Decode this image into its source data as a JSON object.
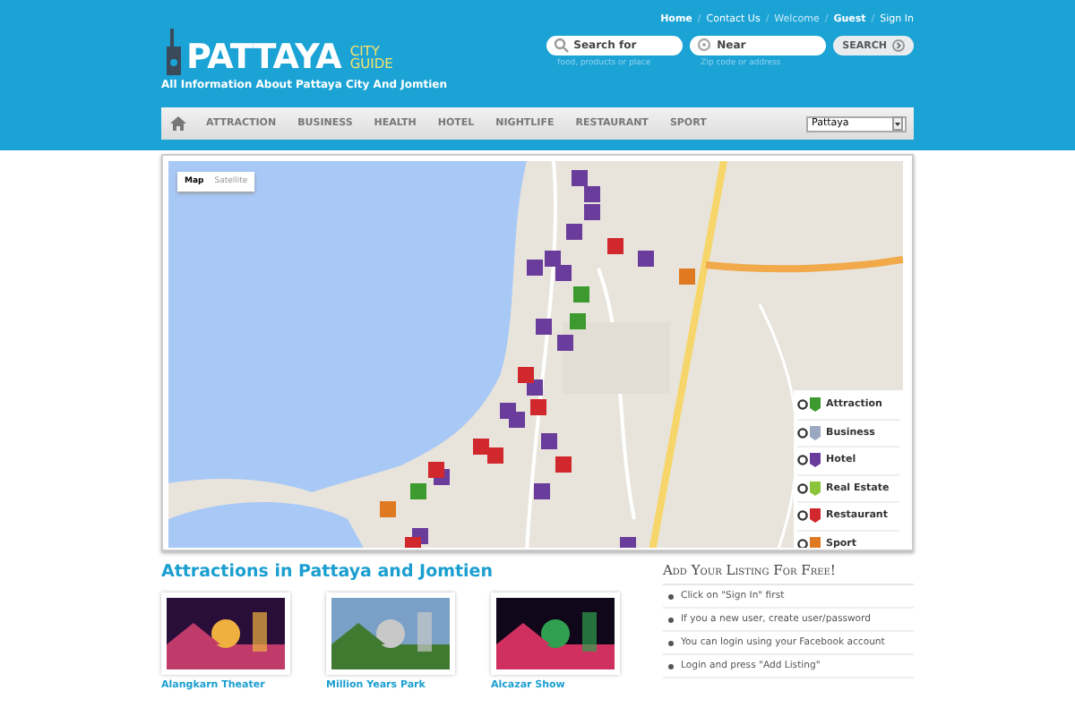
{
  "header": {
    "logo": {
      "name": "PATTAYA",
      "sub_top": "CITY",
      "sub_bottom": "GUIDE"
    },
    "tagline": "All Information About Pattaya City And Jomtien",
    "top_links": [
      {
        "label": "Home",
        "bold": true,
        "kind": "link"
      },
      {
        "label": "/",
        "kind": "separator"
      },
      {
        "label": "Contact Us",
        "bold": false,
        "kind": "link"
      },
      {
        "label": "/",
        "kind": "separator"
      },
      {
        "label": "Welcome",
        "kind": "text"
      },
      {
        "label": "/",
        "kind": "separator"
      },
      {
        "label": "Guest",
        "bold": true,
        "kind": "link"
      },
      {
        "label": "/",
        "kind": "separator"
      },
      {
        "label": "Sign In",
        "bold": false,
        "kind": "link"
      }
    ],
    "search": {
      "what": {
        "placeholder": "Search for",
        "hint": "food, products or place"
      },
      "where": {
        "placeholder": "Near",
        "hint": "Zip code or address"
      },
      "button": "SEARCH"
    }
  },
  "nav": {
    "items": [
      "ATTRACTION",
      "BUSINESS",
      "HEALTH",
      "HOTEL",
      "NIGHTLIFE",
      "RESTAURANT",
      "SPORT"
    ],
    "city": "Pattaya"
  },
  "map": {
    "kind": "picture",
    "types": [
      {
        "label": "Map",
        "selected": true
      },
      {
        "label": "Satellite",
        "selected": false
      }
    ],
    "legend": [
      {
        "label": "Attraction",
        "color": "#3c9a2e"
      },
      {
        "label": "Business",
        "color": "#9aa8c0"
      },
      {
        "label": "Hotel",
        "color": "#6a3c9c"
      },
      {
        "label": "Real Estate",
        "color": "#8cc43c"
      },
      {
        "label": "Restaurant",
        "color": "#d0282c"
      },
      {
        "label": "Sport",
        "color": "#e07a22"
      }
    ]
  },
  "attractions": {
    "title": "Attractions in Pattaya and Jomtien",
    "items": [
      {
        "name": "Alangkarn Theater"
      },
      {
        "name": "Million Years Park"
      },
      {
        "name": "Alcazar Show"
      }
    ]
  },
  "sidebar": {
    "title": "Add Your Listing For Free!",
    "steps": [
      "Click on \"Sign In\" first",
      "If you a new user, create user/password",
      "You can login using your Facebook account",
      "Login and press \"Add Listing\""
    ]
  }
}
